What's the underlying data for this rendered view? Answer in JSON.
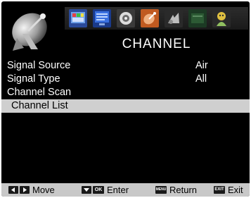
{
  "page": {
    "title": "CHANNEL"
  },
  "tabs": [
    {
      "icon": "picture-icon"
    },
    {
      "icon": "screen-icon"
    },
    {
      "icon": "sound-icon"
    },
    {
      "icon": "channel-icon",
      "active": true
    },
    {
      "icon": "setup-icon"
    },
    {
      "icon": "lock-icon"
    },
    {
      "icon": "parental-icon"
    }
  ],
  "menu": {
    "items": [
      {
        "label": "Signal Source",
        "value": "Air"
      },
      {
        "label": "Signal Type",
        "value": "All"
      },
      {
        "label": "Channel Scan",
        "value": ""
      },
      {
        "label": "Channel List",
        "value": "",
        "selected": true
      }
    ]
  },
  "footer": {
    "move": "Move",
    "ok_key": "OK",
    "enter": "Enter",
    "menu_key": "MENU",
    "return": "Return",
    "exit_key": "EXIT",
    "exit": "Exit"
  },
  "colors": {
    "background": "#000000",
    "highlight": "#cfcfcf",
    "footer": "#c8c8c8",
    "text": "#ffffff"
  }
}
